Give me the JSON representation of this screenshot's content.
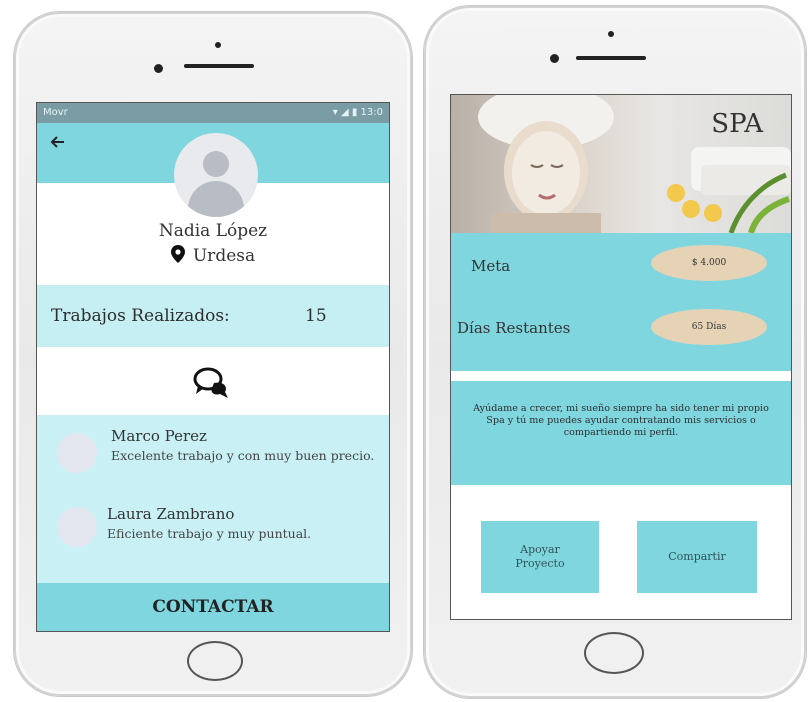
{
  "left_phone": {
    "status_bar": {
      "carrier": "Movr",
      "indicators": "▾ ◢ ▮ 13:0"
    },
    "back_icon": "arrow-left-icon",
    "profile": {
      "name": "Nadia López",
      "location": "Urdesa",
      "location_icon": "map-pin-icon"
    },
    "stats": {
      "label": "Trabajos Realizados:",
      "value": "15"
    },
    "chat_icon": "chat-bubbles-icon",
    "reviews": [
      {
        "name": "Marco Perez",
        "text": "Excelente trabajo y con muy buen precio."
      },
      {
        "name": "Laura Zambrano",
        "text": "Eficiente trabajo y muy puntual."
      }
    ],
    "contact_button": "CONTACTAR"
  },
  "right_phone": {
    "hero": {
      "title": "SPA"
    },
    "goal": {
      "label": "Meta",
      "value": "$ 4.000"
    },
    "days": {
      "label": "Días Restantes",
      "value": "65 Días"
    },
    "description": "Ayúdame a crecer, mi sueño siempre ha sido tener mi propio Spa y tú me puedes ayudar contratando mis servicios o compartiendo mi perfil.",
    "buttons": {
      "support": "Apoyar Proyecto",
      "share": "Compartir"
    }
  },
  "colors": {
    "teal": "#7fd6df",
    "light_teal": "#c5eff3",
    "pill": "#e6d3b6",
    "status_bar": "#7a9da5"
  }
}
